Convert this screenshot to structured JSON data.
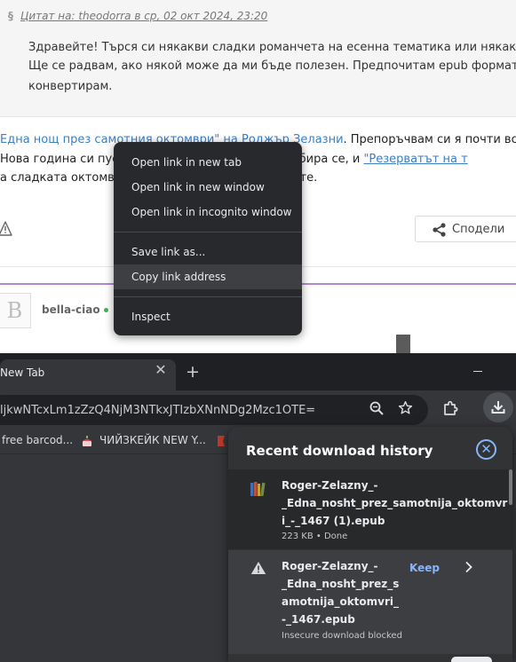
{
  "forum": {
    "quote_cite": "Цитат на: theodorra в ср, 02 окт 2024, 23:20",
    "quote_lines": [
      "Здравейте! Търся си някакви сладки романчета на есенна тематика или някакви по-те",
      "Ще се радвам, ако някой може да ми бъде полезен. Предпочитам epub формат, но не н",
      "конвертирам."
    ],
    "reply": {
      "line1_link": "Една нощ през самотния октомври\" на Роджър Зелазни",
      "line1_rest": ". Препоръчвам си я почти всяка год",
      "line2_start": "Нова година си пуска",
      "line2_mid": "пaрoм\". Разбира се, и ",
      "line2_link": "\"Резерватът на т",
      "line3_start": "а сладката октомвр",
      "line3_end": "ите."
    },
    "share_label": "Сподели",
    "avatar_letter": "B",
    "username": "bella-ciao"
  },
  "context_menu": {
    "items": [
      "Open link in new tab",
      "Open link in new window",
      "Open link in incognito window",
      "Save link as...",
      "Copy link address",
      "Inspect"
    ],
    "highlighted": "Copy link address"
  },
  "browser": {
    "tab_title": "New Tab",
    "new_tab_label": "+",
    "url": "ljkwNTcxLm1zZzQ4NjM3NTkxJTIzbXNnNDg2Mzc1OTE=",
    "bookmarks": [
      "free barcod...",
      "ЧИЙЗКЕЙК NEW Y..."
    ]
  },
  "downloads": {
    "header": "Recent download history",
    "items": [
      {
        "name_lines": [
          "Roger-Zelazny_-",
          "_Edna_nosht_prez_samotnija_oktomvr",
          "i_-_1467 (1).epub"
        ],
        "status": "223 KB • Done",
        "icon": "books-icon"
      },
      {
        "name_lines": [
          "Roger-Zelazny_-",
          "_Edna_nosht_prez_s",
          "amotnija_oktomvri_",
          "-_1467.epub"
        ],
        "status": "Insecure download blocked",
        "icon": "warning-icon",
        "action": "Keep"
      }
    ]
  },
  "colors": {
    "link": "#3b7fc4",
    "accent_blue": "#8ab4f8",
    "menu_bg": "#28292c",
    "chrome_bg": "#35363a",
    "online": "#3fb34f",
    "post_divider": "#b08ad0"
  }
}
